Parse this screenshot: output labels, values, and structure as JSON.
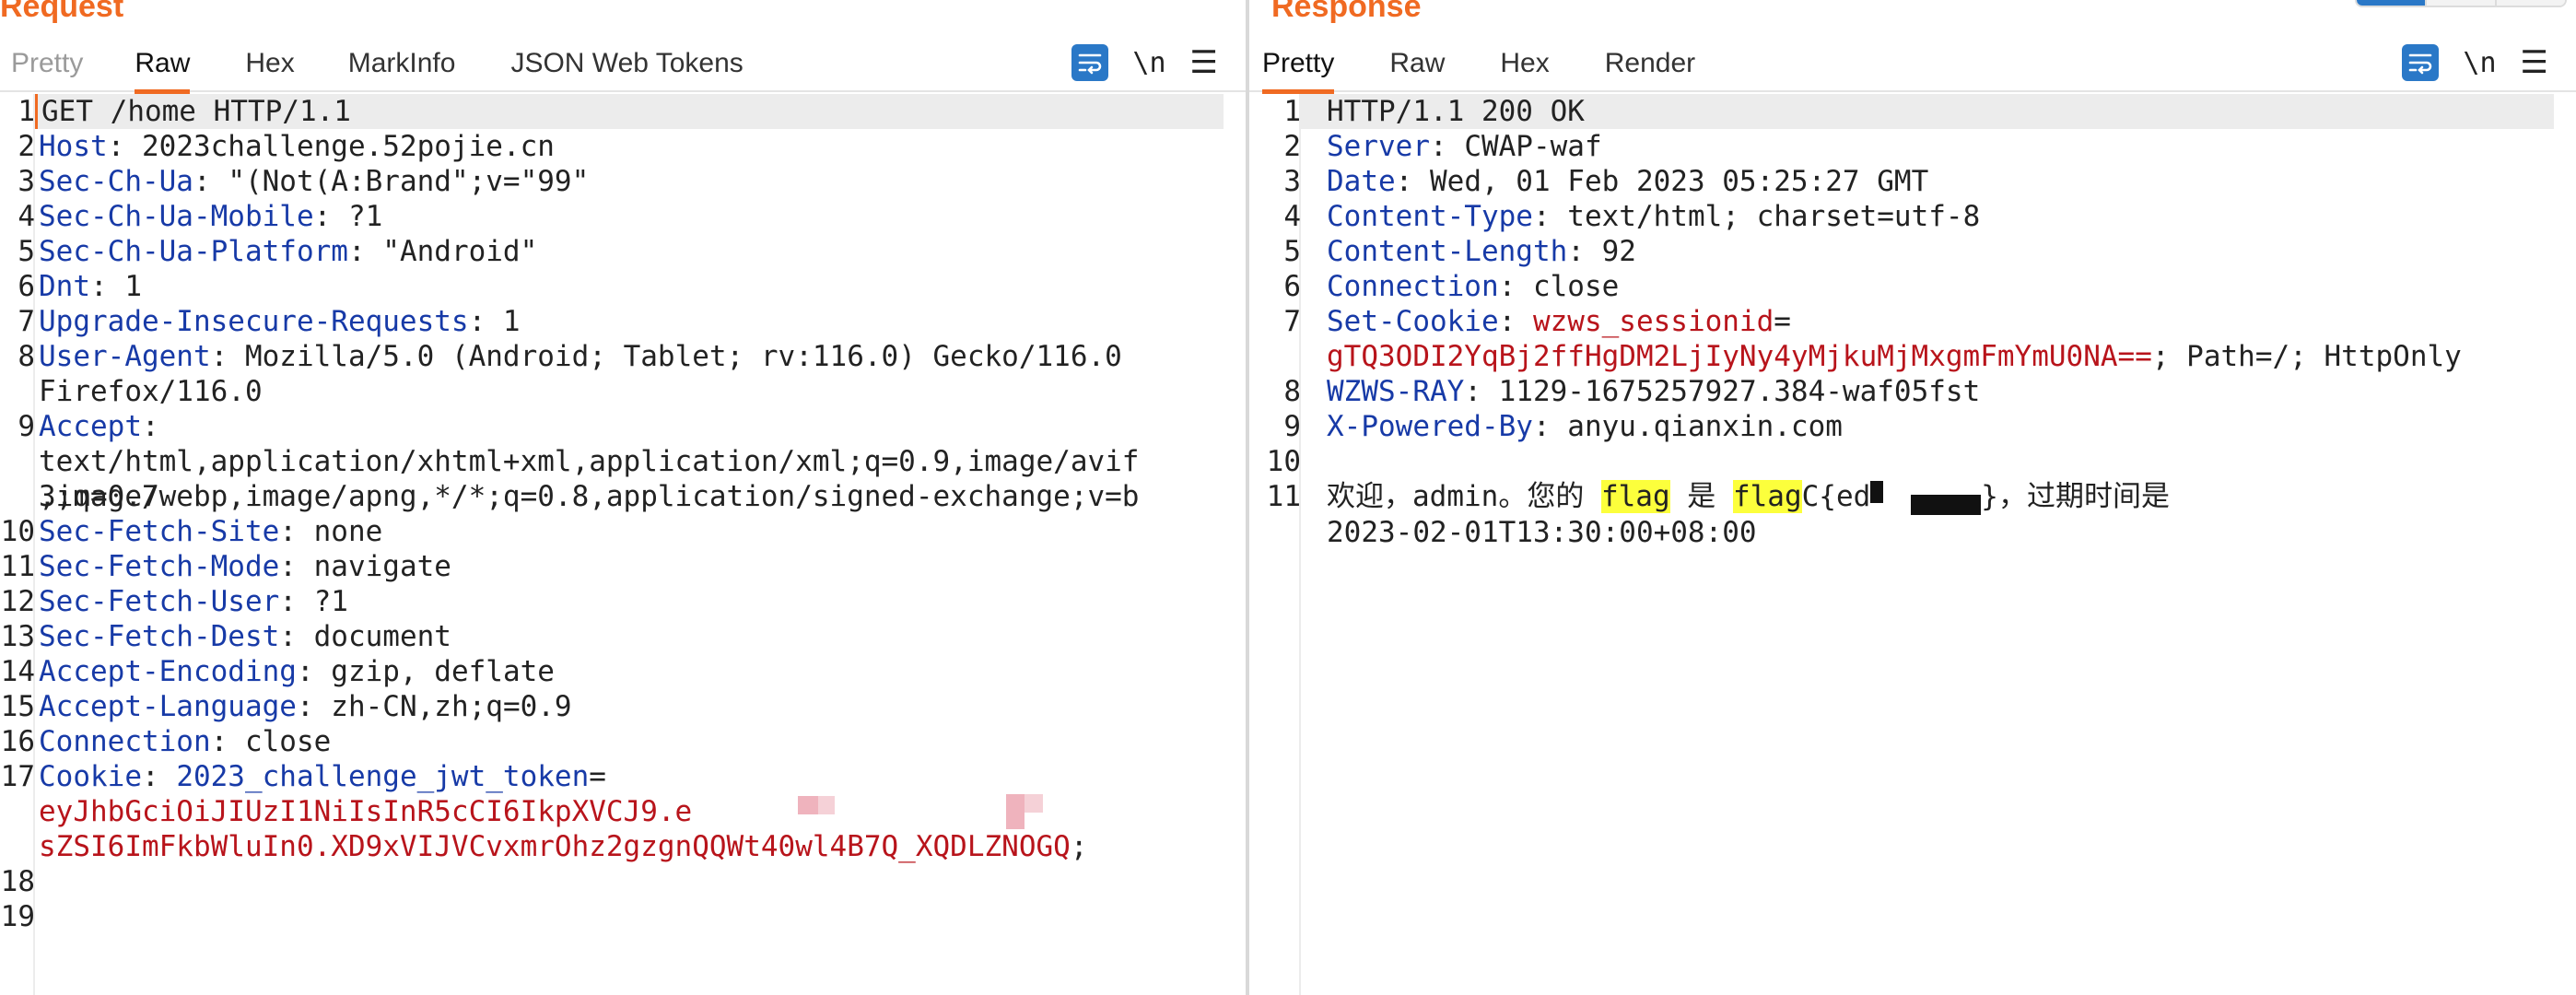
{
  "request": {
    "title": "Request",
    "tabs": [
      "Pretty",
      "Raw",
      "Hex",
      "MarkInfo",
      "JSON Web Tokens"
    ],
    "active_tab": "Raw",
    "newline_label": "\\n",
    "line_numbers": [
      "1",
      "2",
      "3",
      "4",
      "5",
      "6",
      "7",
      "8",
      "",
      "9",
      "",
      "",
      "10",
      "11",
      "12",
      "13",
      "14",
      "15",
      "16",
      "17",
      "",
      "",
      "18",
      "19"
    ],
    "lines": {
      "l1": "GET /home HTTP/1.1",
      "l2k": "Host",
      "l2v": " 2023challenge.52pojie.cn",
      "l3k": "Sec-Ch-Ua",
      "l3v": " \"(Not(A:Brand\";v=\"99\"",
      "l4k": "Sec-Ch-Ua-Mobile",
      "l4v": " ?1",
      "l5k": "Sec-Ch-Ua-Platform",
      "l5v": " \"Android\"",
      "l6k": "Dnt",
      "l6v": " 1",
      "l7k": "Upgrade-Insecure-Requests",
      "l7v": " 1",
      "l8k": "User-Agent",
      "l8v": " Mozilla/5.0 (Android; Tablet; rv:116.0) Gecko/116.0",
      "l8b": "Firefox/116.0",
      "l9k": "Accept",
      "l9a": "text/html,application/xhtml+xml,application/xml;q=0.9,image/avif",
      "l9b": ",image/webp,image/apng,*/*;q=0.8,application/signed-exchange;v=b",
      "l9c": "3;q=0.7",
      "l10k": "Sec-Fetch-Site",
      "l10v": " none",
      "l11k": "Sec-Fetch-Mode",
      "l11v": " navigate",
      "l12k": "Sec-Fetch-User",
      "l12v": " ?1",
      "l13k": "Sec-Fetch-Dest",
      "l13v": " document",
      "l14k": "Accept-Encoding",
      "l14v": " gzip, deflate",
      "l15k": "Accept-Language",
      "l15v": " zh-CN,zh;q=0.9",
      "l16k": "Connection",
      "l16v": " close",
      "l17k": "Cookie",
      "l17n": "2023_challenge_jwt_token",
      "l17eq": "=",
      "l17a": "eyJhbGciOiJIUzI1NiIsInR5cCI6IkpXVCJ9.e",
      "l17b": "sZSI6ImFkbWluIn0.XD9xVIJVCvxmrOhz2gzgnQQWt40wl4B7Q_XQDLZNOGQ",
      "l17end": ";"
    }
  },
  "response": {
    "title": "Response",
    "tabs": [
      "Pretty",
      "Raw",
      "Hex",
      "Render"
    ],
    "active_tab": "Pretty",
    "newline_label": "\\n",
    "line_numbers": [
      "1",
      "2",
      "3",
      "4",
      "5",
      "6",
      "7",
      "",
      "8",
      "9",
      "10",
      "11",
      ""
    ],
    "lines": {
      "l1": "HTTP/1.1 200 OK",
      "l2k": "Server",
      "l2v": " CWAP-waf",
      "l3k": "Date",
      "l3v": " Wed, 01 Feb 2023 05:25:27 GMT",
      "l4k": "Content-Type",
      "l4v": " text/html; charset=utf-8",
      "l5k": "Content-Length",
      "l5v": " 92",
      "l6k": "Connection",
      "l6v": " close",
      "l7k": "Set-Cookie",
      "l7n": "wzws_sessionid",
      "l7eq": "=",
      "l7val": "gTQ3ODI2YqBj2ffHgDM2LjIyNy4yMjkuMjMxgmFmYmU0NA==",
      "l7rest": "; Path=/; HttpOnly",
      "l8k": "WZWS-RAY",
      "l8v": " 1129-1675257927.384-waf05fst",
      "l9k": "X-Powered-By",
      "l9v": " anyu.qianxin.com",
      "l11a": "欢迎，admin。您的 ",
      "l11flag1": "flag",
      "l11b": " 是 ",
      "l11flag2": "flag",
      "l11c": "C{ed",
      "l11d": "}，过期时间是",
      "l11e": "2023-02-01T13:30:00+08:00"
    }
  },
  "colors": {
    "accent": "#f06a22",
    "header_key": "#173aa7",
    "string_value": "#b8141b",
    "highlight": "#fcff3c",
    "wrap_button": "#2a78c7"
  }
}
